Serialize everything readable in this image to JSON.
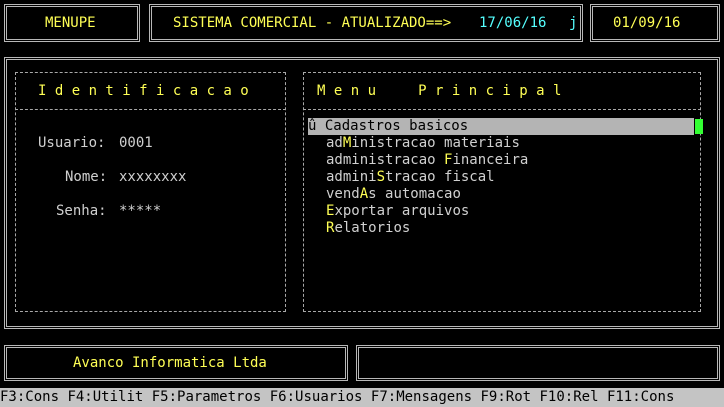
{
  "header": {
    "program": "MENUPE",
    "system_title": "SISTEMA COMERCIAL - ATUALIZADO==>",
    "updated_date": "17/06/16",
    "flag": "j",
    "current_date": "01/09/16"
  },
  "identification": {
    "title": "I d e n t i f i c a c a o",
    "user_label": "Usuario:",
    "user_value": "0001",
    "name_label": "Nome:",
    "name_value": "xxxxxxxx",
    "password_label": "Senha:",
    "password_value": "*****"
  },
  "menu": {
    "title": "M e n u     P r i n c i p a l",
    "selected_marker": "û",
    "items": [
      {
        "pre": "",
        "hot": "C",
        "post": "adastros basicos"
      },
      {
        "pre": "ad",
        "hot": "M",
        "post": "inistracao materiais"
      },
      {
        "pre": "administracao ",
        "hot": "F",
        "post": "inanceira"
      },
      {
        "pre": "admini",
        "hot": "S",
        "post": "tracao fiscal"
      },
      {
        "pre": "vend",
        "hot": "A",
        "post": "s automacao"
      },
      {
        "pre": "",
        "hot": "E",
        "post": "xportar arquivos"
      },
      {
        "pre": "",
        "hot": "R",
        "post": "elatorios"
      }
    ]
  },
  "footer": {
    "company": "Avanco Informatica Ltda"
  },
  "function_keys": [
    "F3:Cons",
    "F4:Utilit",
    "F5:Parametros",
    "F6:Usuarios",
    "F7:Mensagens",
    "F9:Rot",
    "F10:Rel",
    "F11:Cons"
  ],
  "colors": {
    "background": "#000000",
    "accent_yellow": "#ffff55",
    "accent_cyan": "#55ffff",
    "selection_bar": "#b4b4b4",
    "cursor_green": "#33ff33",
    "fkey_bar": "#c4c4c4"
  }
}
